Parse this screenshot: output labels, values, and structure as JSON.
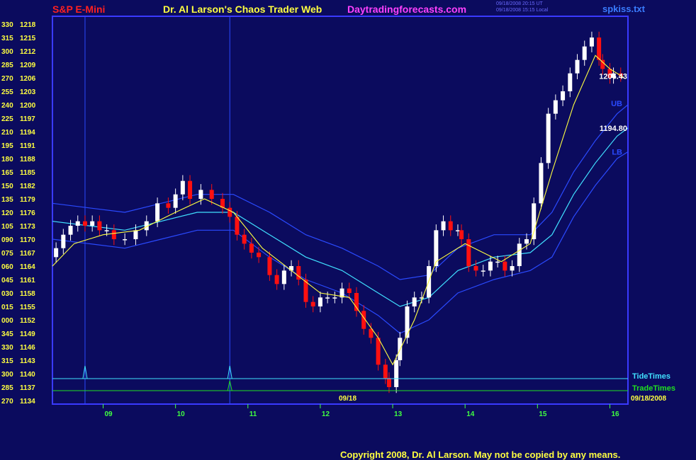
{
  "header": {
    "symbol": "S&P E-Mini",
    "title": "Dr. Al Larson's Chaos Trader Web",
    "site": "Daytradingforecasts.com",
    "file": "spkiss.txt",
    "stamp_line1": "09/18/2008 20:15 UT",
    "stamp_line2": "09/18/2008 15:15 Local"
  },
  "footer": {
    "copyright": "Copyright 2008, Dr. Al Larson. May not be copied by any means."
  },
  "colors": {
    "background": "#0b0b5e",
    "frame": "#3a3aff",
    "up_candle": "#ffffff",
    "down_candle": "#ff1010",
    "ema_short": "#ffff40",
    "mid_band": "#40e0ff",
    "outer_band": "#2a4aff",
    "tide_times": "#40e0ff",
    "trade_times": "#20e020",
    "price_label": "#ffffff",
    "axis_time": "#40ff40",
    "axis_price": "#ffff40"
  },
  "chart_data": {
    "type": "candlestick",
    "x_axis": {
      "label": "",
      "ticks": [
        "09",
        "10",
        "11",
        "12",
        "13",
        "14",
        "15",
        "16"
      ],
      "date_marker": "09/18",
      "end_label": "09/18/2008"
    },
    "y_axis": {
      "label": "",
      "range": [
        1134,
        1218
      ],
      "price_ticks": [
        1218,
        1215,
        1212,
        1209,
        1206,
        1203,
        1200,
        1197,
        1194,
        1191,
        1188,
        1185,
        1182,
        1179,
        1176,
        1173,
        1170,
        1167,
        1164,
        1161,
        1158,
        1155,
        1152,
        1149,
        1146,
        1143,
        1140,
        1137,
        1134
      ],
      "minute_ticks": [
        "330",
        "315",
        "300",
        "285",
        "270",
        "255",
        "240",
        "225",
        "210",
        "195",
        "180",
        "165",
        "150",
        "135",
        "120",
        "105",
        "090",
        "075",
        "060",
        "045",
        "030",
        "015",
        "000",
        "345",
        "330",
        "315",
        "300",
        "285",
        "270"
      ]
    },
    "x_range": [
      8.3,
      16.25
    ],
    "vertical_lines": [
      8.75,
      10.75
    ],
    "price_labels": [
      {
        "text": "1206.43",
        "y": 1206.43
      },
      {
        "text": "1194.80",
        "y": 1194.8
      }
    ],
    "band_labels": [
      {
        "text": "UB",
        "y": 1200.3
      },
      {
        "text": "LB",
        "y": 1189.5
      }
    ],
    "legend": [
      "TideTimes",
      "TradeTimes"
    ],
    "tide_spikes": [
      8.75,
      10.75
    ],
    "trade_spikes": [
      10.75
    ],
    "close_points": [
      [
        8.35,
        1168
      ],
      [
        8.45,
        1171
      ],
      [
        8.55,
        1173
      ],
      [
        8.65,
        1174
      ],
      [
        8.75,
        1173
      ],
      [
        8.85,
        1174
      ],
      [
        8.95,
        1172
      ],
      [
        9.05,
        1172
      ],
      [
        9.15,
        1170
      ],
      [
        9.3,
        1170
      ],
      [
        9.45,
        1172
      ],
      [
        9.6,
        1174
      ],
      [
        9.75,
        1178
      ],
      [
        9.9,
        1177
      ],
      [
        10.0,
        1180
      ],
      [
        10.1,
        1183
      ],
      [
        10.2,
        1179
      ],
      [
        10.35,
        1181
      ],
      [
        10.5,
        1179
      ],
      [
        10.65,
        1177
      ],
      [
        10.75,
        1175
      ],
      [
        10.85,
        1171
      ],
      [
        10.95,
        1169
      ],
      [
        11.05,
        1167
      ],
      [
        11.15,
        1166
      ],
      [
        11.3,
        1162
      ],
      [
        11.4,
        1160
      ],
      [
        11.5,
        1163
      ],
      [
        11.6,
        1164
      ],
      [
        11.7,
        1161
      ],
      [
        11.8,
        1156
      ],
      [
        11.9,
        1155
      ],
      [
        12.0,
        1157
      ],
      [
        12.1,
        1157
      ],
      [
        12.2,
        1157
      ],
      [
        12.3,
        1159
      ],
      [
        12.4,
        1158
      ],
      [
        12.5,
        1154
      ],
      [
        12.6,
        1150
      ],
      [
        12.7,
        1148
      ],
      [
        12.8,
        1142
      ],
      [
        12.9,
        1139
      ],
      [
        12.95,
        1137
      ],
      [
        13.05,
        1143
      ],
      [
        13.1,
        1148
      ],
      [
        13.2,
        1155
      ],
      [
        13.3,
        1157
      ],
      [
        13.4,
        1157
      ],
      [
        13.5,
        1164
      ],
      [
        13.6,
        1172
      ],
      [
        13.7,
        1174
      ],
      [
        13.8,
        1172
      ],
      [
        13.9,
        1172
      ],
      [
        13.95,
        1170
      ],
      [
        14.05,
        1164
      ],
      [
        14.15,
        1163
      ],
      [
        14.25,
        1163
      ],
      [
        14.35,
        1165
      ],
      [
        14.45,
        1165
      ],
      [
        14.55,
        1163
      ],
      [
        14.65,
        1164
      ],
      [
        14.75,
        1169
      ],
      [
        14.85,
        1170
      ],
      [
        14.95,
        1178
      ],
      [
        15.05,
        1187
      ],
      [
        15.15,
        1198
      ],
      [
        15.25,
        1201
      ],
      [
        15.35,
        1203
      ],
      [
        15.45,
        1207
      ],
      [
        15.55,
        1210
      ],
      [
        15.65,
        1213
      ],
      [
        15.75,
        1215
      ],
      [
        15.85,
        1210
      ],
      [
        15.9,
        1208
      ],
      [
        16.0,
        1206
      ],
      [
        16.05,
        1207
      ],
      [
        16.15,
        1206.43
      ]
    ],
    "ema_points": [
      [
        8.3,
        1164
      ],
      [
        8.6,
        1169
      ],
      [
        9.0,
        1171
      ],
      [
        9.5,
        1172
      ],
      [
        10.0,
        1176
      ],
      [
        10.4,
        1179
      ],
      [
        10.8,
        1176
      ],
      [
        11.2,
        1168
      ],
      [
        11.6,
        1163
      ],
      [
        12.0,
        1158
      ],
      [
        12.4,
        1157
      ],
      [
        12.8,
        1148
      ],
      [
        13.0,
        1142
      ],
      [
        13.3,
        1152
      ],
      [
        13.6,
        1165
      ],
      [
        14.0,
        1169
      ],
      [
        14.5,
        1165
      ],
      [
        14.9,
        1169
      ],
      [
        15.2,
        1185
      ],
      [
        15.5,
        1200
      ],
      [
        15.8,
        1211
      ],
      [
        16.0,
        1208
      ],
      [
        16.2,
        1206
      ]
    ],
    "mid_band_points": [
      [
        8.3,
        1174
      ],
      [
        8.8,
        1173
      ],
      [
        9.3,
        1172
      ],
      [
        9.8,
        1174
      ],
      [
        10.3,
        1176
      ],
      [
        10.8,
        1176
      ],
      [
        11.3,
        1171
      ],
      [
        11.8,
        1166
      ],
      [
        12.3,
        1163
      ],
      [
        12.8,
        1158
      ],
      [
        13.1,
        1155
      ],
      [
        13.5,
        1157
      ],
      [
        13.9,
        1163
      ],
      [
        14.4,
        1166
      ],
      [
        14.9,
        1167
      ],
      [
        15.2,
        1171
      ],
      [
        15.5,
        1180
      ],
      [
        15.8,
        1187
      ],
      [
        16.1,
        1193
      ],
      [
        16.25,
        1194.8
      ]
    ],
    "upper_band_points": [
      [
        8.3,
        1178
      ],
      [
        8.8,
        1177
      ],
      [
        9.3,
        1176
      ],
      [
        9.8,
        1178
      ],
      [
        10.3,
        1180
      ],
      [
        10.8,
        1180
      ],
      [
        11.3,
        1176
      ],
      [
        11.8,
        1171
      ],
      [
        12.3,
        1168
      ],
      [
        12.8,
        1164
      ],
      [
        13.1,
        1161
      ],
      [
        13.5,
        1162
      ],
      [
        13.9,
        1168
      ],
      [
        14.4,
        1171
      ],
      [
        14.9,
        1171
      ],
      [
        15.2,
        1176
      ],
      [
        15.5,
        1185
      ],
      [
        15.8,
        1192
      ],
      [
        16.1,
        1198
      ],
      [
        16.25,
        1200
      ]
    ],
    "lower_band_points": [
      [
        8.3,
        1170
      ],
      [
        8.8,
        1169
      ],
      [
        9.3,
        1168
      ],
      [
        9.8,
        1170
      ],
      [
        10.3,
        1172
      ],
      [
        10.8,
        1172
      ],
      [
        11.3,
        1166
      ],
      [
        11.8,
        1161
      ],
      [
        12.3,
        1158
      ],
      [
        12.8,
        1153
      ],
      [
        13.1,
        1149
      ],
      [
        13.5,
        1152
      ],
      [
        13.9,
        1158
      ],
      [
        14.4,
        1161
      ],
      [
        14.9,
        1163
      ],
      [
        15.2,
        1166
      ],
      [
        15.5,
        1175
      ],
      [
        15.8,
        1182
      ],
      [
        16.1,
        1188
      ],
      [
        16.25,
        1189.5
      ]
    ]
  }
}
